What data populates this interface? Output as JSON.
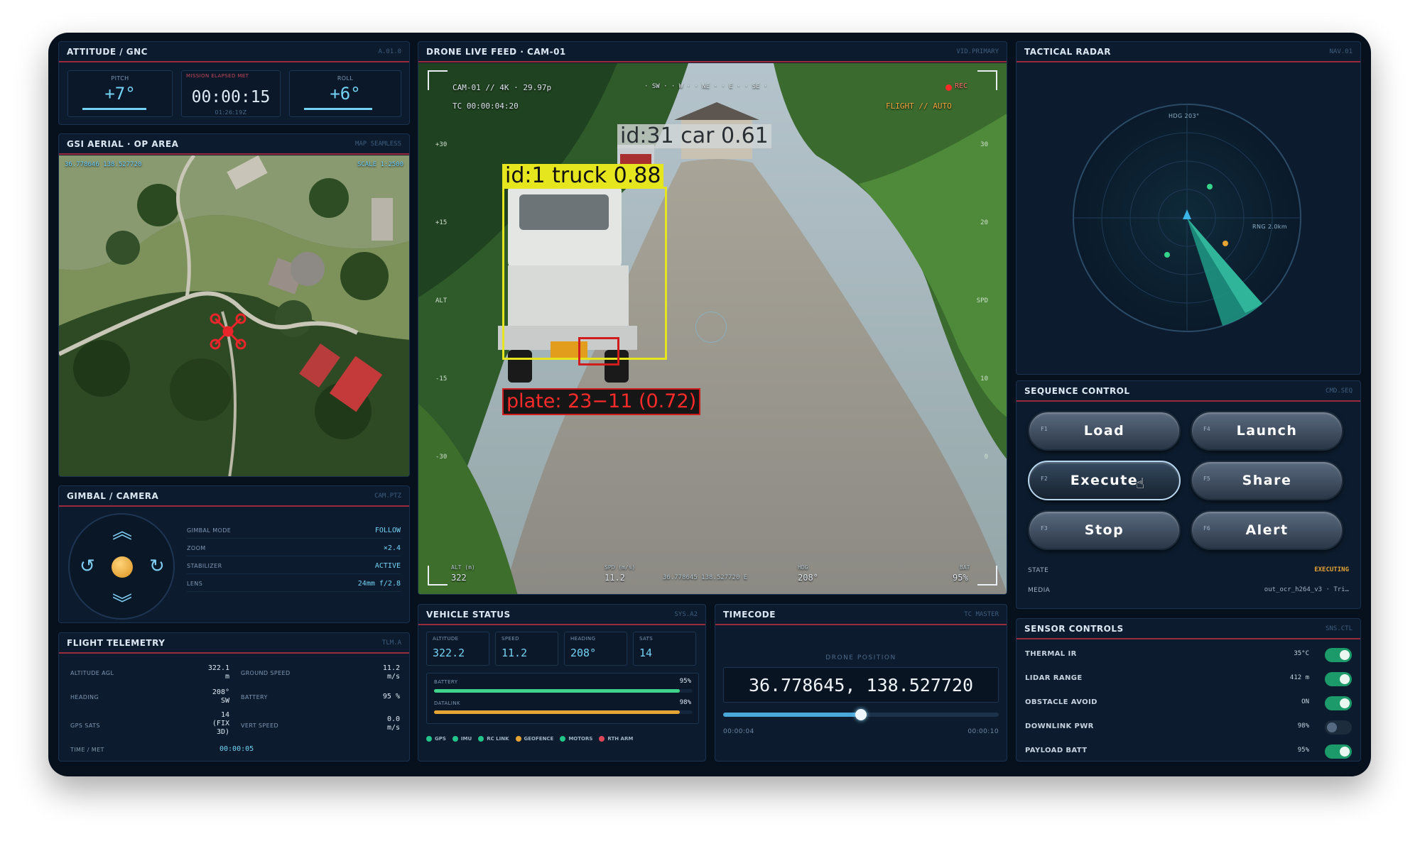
{
  "attitude": {
    "title": "ATTITUDE / GNC",
    "code": "A.01.0",
    "pitch_label": "PITCH",
    "pitch": "+7°",
    "met_label": "MISSION ELAPSED MET",
    "met": "00:00:15",
    "met_sub": "01:26:19Z",
    "roll_label": "ROLL",
    "roll": "+6°"
  },
  "aerial": {
    "title": "GSI AERIAL · OP AREA",
    "code": "MAP SEAMLESS",
    "coord": "36.778646 138.527720",
    "scale": "SCALE 1:2500"
  },
  "gimbal": {
    "title": "GIMBAL / CAMERA",
    "code": "CAM.PTZ",
    "rows": [
      {
        "label": "GIMBAL MODE",
        "value": "FOLLOW"
      },
      {
        "label": "ZOOM",
        "value": "×2.4"
      },
      {
        "label": "STABILIZER",
        "value": "ACTIVE"
      },
      {
        "label": "LENS",
        "value": "24mm f/2.8"
      }
    ]
  },
  "telemetry": {
    "title": "FLIGHT TELEMETRY",
    "code": "TLM.A",
    "alt_label": "ALTITUDE AGL",
    "alt_value": "322.1",
    "alt_unit": "m",
    "gs_label": "GROUND SPEED",
    "gs_value": "11.2",
    "gs_unit": "m/s",
    "hdg_label": "HEADING",
    "hdg_value": "208°",
    "hdg_unit": "SW",
    "batt_label": "BATTERY",
    "batt_value": "95 %",
    "gps_label": "GPS SATS",
    "gps_value": "14",
    "gps_fix": "(FIX",
    "gps_fix2": "3D)",
    "vs_label": "VERT SPEED",
    "vs_value": "0.0",
    "vs_unit": "m/s",
    "time_label": "TIME / MET",
    "time_value": "00:00:05"
  },
  "feed": {
    "title": "DRONE LIVE FEED · CAM-01",
    "code": "VID.PRIMARY",
    "cam": "CAM-01 // 4K · 29.97p",
    "tc": "TC 00:00:04:20",
    "compass": "· SW · · W · · NE · · E · · SE ·",
    "rec": "REC",
    "mode": "FLIGHT // AUTO",
    "left_ticks": [
      "+30",
      "+15",
      "ALT",
      "-15",
      "-30"
    ],
    "right_ticks": [
      "30",
      "20",
      "SPD",
      "10",
      "0"
    ],
    "b_alt_l": "ALT (m)",
    "b_alt": "322",
    "b_spd_l": "SPD (m/s)",
    "b_spd": "11.2",
    "b_coord": "36.778645 138.527720 E",
    "b_hdg_l": "HDG",
    "b_hdg": "208°",
    "b_bat_l": "BAT",
    "b_bat": "95%"
  },
  "detections": {
    "car": "id:31  car  0.61",
    "truck": "id:1  truck  0.88",
    "plate": "plate: 23−11 (0.72)"
  },
  "vehicle": {
    "title": "VEHICLE STATUS",
    "code": "SYS.A2",
    "cells": [
      {
        "label": "ALTITUDE",
        "value": "322.2"
      },
      {
        "label": "SPEED",
        "value": "11.2"
      },
      {
        "label": "HEADING",
        "value": "208°"
      },
      {
        "label": "SATS",
        "value": "14"
      }
    ],
    "battery_label": "BATTERY",
    "battery_value": "95%",
    "battery_level": 0.95,
    "datalink_label": "DATALINK",
    "datalink_value": "98%",
    "datalink_level": 0.98,
    "legend": [
      {
        "label": "GPS",
        "color": "#22c48a"
      },
      {
        "label": "IMU",
        "color": "#22c48a"
      },
      {
        "label": "RC LINK",
        "color": "#22c48a"
      },
      {
        "label": "GEOFENCE",
        "color": "#e5a434"
      },
      {
        "label": "MOTORS",
        "color": "#22c48a"
      },
      {
        "label": "RTH ARM",
        "color": "#e04858"
      }
    ]
  },
  "timecode": {
    "title": "TIMECODE",
    "code": "TC MASTER",
    "pos_label": "DRONE POSITION",
    "position": "36.778645, 138.527720",
    "progress": 0.5,
    "start": "00:00:04",
    "end": "00:00:10"
  },
  "radar": {
    "title": "TACTICAL RADAR",
    "code": "NAV.01",
    "hdg": "HDG 203°",
    "rng": "RNG 2.0km"
  },
  "sequence": {
    "title": "SEQUENCE CONTROL",
    "code": "CMD.SEQ",
    "buttons": [
      {
        "label": "Load",
        "key": "F1"
      },
      {
        "label": "Launch",
        "key": "F4"
      },
      {
        "label": "Execute",
        "key": "F2"
      },
      {
        "label": "Share",
        "key": "F5"
      },
      {
        "label": "Stop",
        "key": "F3"
      },
      {
        "label": "Alert",
        "key": "F6"
      }
    ],
    "state_label": "STATE",
    "state_value": "EXECUTING",
    "media_label": "MEDIA",
    "media_value": "out_ocr_h264_v3 · Tri…"
  },
  "sensors": {
    "title": "SENSOR CONTROLS",
    "code": "SNS.CTL",
    "rows": [
      {
        "label": "THERMAL IR",
        "value": "35°C",
        "on": true
      },
      {
        "label": "LIDAR RANGE",
        "value": "412 m",
        "on": true
      },
      {
        "label": "OBSTACLE AVOID",
        "value": "ON",
        "on": true
      },
      {
        "label": "DOWNLINK PWR",
        "value": "98%",
        "on": false
      },
      {
        "label": "PAYLOAD BATT",
        "value": "95%",
        "on": true
      }
    ]
  },
  "colors": {
    "accent": "#74d3f5",
    "alert_red": "#9b2a3c",
    "ok_green": "#1d9a6a",
    "amber": "#e5a434",
    "truck_box": "#e6e61e",
    "plate_box": "#d01c1c"
  }
}
